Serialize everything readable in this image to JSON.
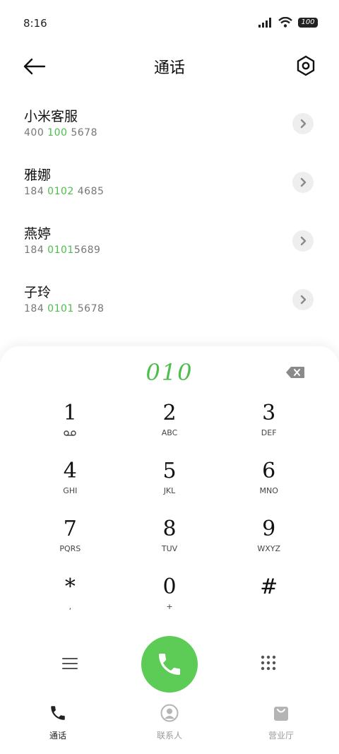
{
  "status_bar": {
    "time": "8:16",
    "battery": "100"
  },
  "header": {
    "title": "通话"
  },
  "contacts": [
    {
      "name": "小米客服",
      "number_parts": [
        "400 ",
        "100",
        " 5678"
      ]
    },
    {
      "name": "雅娜",
      "number_parts": [
        "184 ",
        "0102",
        " 4685"
      ]
    },
    {
      "name": "燕婷",
      "number_parts": [
        "184 ",
        "0101",
        "5689"
      ]
    },
    {
      "name": "子玲",
      "number_parts": [
        "184 ",
        "0101",
        " 5678"
      ]
    }
  ],
  "dialpad": {
    "input_value": "010",
    "keys": [
      {
        "num": "1",
        "sub": ""
      },
      {
        "num": "2",
        "sub": "ABC"
      },
      {
        "num": "3",
        "sub": "DEF"
      },
      {
        "num": "4",
        "sub": "GHI"
      },
      {
        "num": "5",
        "sub": "JKL"
      },
      {
        "num": "6",
        "sub": "MNO"
      },
      {
        "num": "7",
        "sub": "PQRS"
      },
      {
        "num": "8",
        "sub": "TUV"
      },
      {
        "num": "9",
        "sub": "WXYZ"
      },
      {
        "num": "*",
        "sub": ","
      },
      {
        "num": "0",
        "sub": "+"
      },
      {
        "num": "#",
        "sub": ""
      }
    ]
  },
  "tabs": [
    {
      "label": "通话",
      "icon": "phone-icon",
      "active": true
    },
    {
      "label": "联系人",
      "icon": "contacts-icon",
      "active": false
    },
    {
      "label": "营业厅",
      "icon": "store-bag-icon",
      "active": false
    }
  ],
  "colors": {
    "accent": "#4cbe4c",
    "call_button": "#5ccc56"
  }
}
